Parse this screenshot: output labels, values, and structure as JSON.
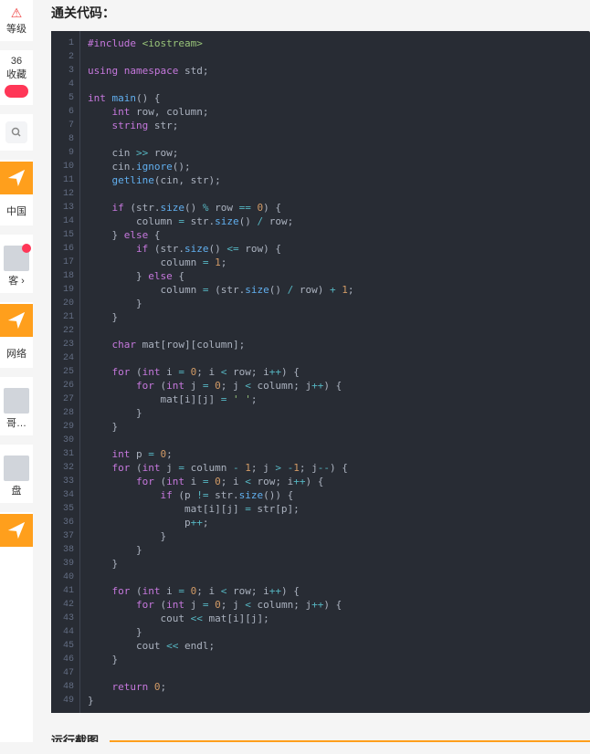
{
  "sidebar": {
    "level_label": "等级",
    "count": "36",
    "fav_label": "收藏",
    "country_label": "中国",
    "guest_label": "客 ›",
    "net_label": "网络",
    "dot_label": "哥…",
    "disk_label": "盘"
  },
  "heading": "通关代码：",
  "colors": {
    "bg": "#282c34",
    "gutter": "#636d83",
    "kw": "#c678dd",
    "id": "#e06c75",
    "fn": "#61afef",
    "num": "#d19a66",
    "op": "#56b6c2",
    "str": "#98c379"
  },
  "code": {
    "language": "cpp",
    "lines": [
      [
        [
          "pp",
          "#include"
        ],
        [
          "pl",
          " "
        ],
        [
          "inc",
          "<iostream>"
        ]
      ],
      [],
      [
        [
          "kw",
          "using"
        ],
        [
          "pl",
          " "
        ],
        [
          "kw",
          "namespace"
        ],
        [
          "pl",
          " std;"
        ]
      ],
      [],
      [
        [
          "ty",
          "int"
        ],
        [
          "pl",
          " "
        ],
        [
          "fn",
          "main"
        ],
        [
          "pl",
          "() {"
        ]
      ],
      [
        [
          "pl",
          "    "
        ],
        [
          "ty",
          "int"
        ],
        [
          "pl",
          " row, column;"
        ]
      ],
      [
        [
          "pl",
          "    "
        ],
        [
          "ty",
          "string"
        ],
        [
          "pl",
          " str;"
        ]
      ],
      [],
      [
        [
          "pl",
          "    cin "
        ],
        [
          "op",
          ">>"
        ],
        [
          "pl",
          " row;"
        ]
      ],
      [
        [
          "pl",
          "    cin."
        ],
        [
          "fn",
          "ignore"
        ],
        [
          "pl",
          "();"
        ]
      ],
      [
        [
          "pl",
          "    "
        ],
        [
          "fn",
          "getline"
        ],
        [
          "pl",
          "(cin, str);"
        ]
      ],
      [],
      [
        [
          "pl",
          "    "
        ],
        [
          "kw",
          "if"
        ],
        [
          "pl",
          " (str."
        ],
        [
          "fn",
          "size"
        ],
        [
          "pl",
          "() "
        ],
        [
          "op",
          "%"
        ],
        [
          "pl",
          " row "
        ],
        [
          "op",
          "=="
        ],
        [
          "pl",
          " "
        ],
        [
          "num",
          "0"
        ],
        [
          "pl",
          ") {"
        ]
      ],
      [
        [
          "pl",
          "        column "
        ],
        [
          "op",
          "="
        ],
        [
          "pl",
          " str."
        ],
        [
          "fn",
          "size"
        ],
        [
          "pl",
          "() "
        ],
        [
          "op",
          "/"
        ],
        [
          "pl",
          " row;"
        ]
      ],
      [
        [
          "pl",
          "    } "
        ],
        [
          "kw",
          "else"
        ],
        [
          "pl",
          " {"
        ]
      ],
      [
        [
          "pl",
          "        "
        ],
        [
          "kw",
          "if"
        ],
        [
          "pl",
          " (str."
        ],
        [
          "fn",
          "size"
        ],
        [
          "pl",
          "() "
        ],
        [
          "op",
          "<="
        ],
        [
          "pl",
          " row) {"
        ]
      ],
      [
        [
          "pl",
          "            column "
        ],
        [
          "op",
          "="
        ],
        [
          "pl",
          " "
        ],
        [
          "num",
          "1"
        ],
        [
          "pl",
          ";"
        ]
      ],
      [
        [
          "pl",
          "        } "
        ],
        [
          "kw",
          "else"
        ],
        [
          "pl",
          " {"
        ]
      ],
      [
        [
          "pl",
          "            column "
        ],
        [
          "op",
          "="
        ],
        [
          "pl",
          " (str."
        ],
        [
          "fn",
          "size"
        ],
        [
          "pl",
          "() "
        ],
        [
          "op",
          "/"
        ],
        [
          "pl",
          " row) "
        ],
        [
          "op",
          "+"
        ],
        [
          "pl",
          " "
        ],
        [
          "num",
          "1"
        ],
        [
          "pl",
          ";"
        ]
      ],
      [
        [
          "pl",
          "        }"
        ]
      ],
      [
        [
          "pl",
          "    }"
        ]
      ],
      [],
      [
        [
          "pl",
          "    "
        ],
        [
          "ty",
          "char"
        ],
        [
          "pl",
          " mat[row][column];"
        ]
      ],
      [],
      [
        [
          "pl",
          "    "
        ],
        [
          "kw",
          "for"
        ],
        [
          "pl",
          " ("
        ],
        [
          "ty",
          "int"
        ],
        [
          "pl",
          " i "
        ],
        [
          "op",
          "="
        ],
        [
          "pl",
          " "
        ],
        [
          "num",
          "0"
        ],
        [
          "pl",
          "; i "
        ],
        [
          "op",
          "<"
        ],
        [
          "pl",
          " row; i"
        ],
        [
          "op",
          "++"
        ],
        [
          "pl",
          ") {"
        ]
      ],
      [
        [
          "pl",
          "        "
        ],
        [
          "kw",
          "for"
        ],
        [
          "pl",
          " ("
        ],
        [
          "ty",
          "int"
        ],
        [
          "pl",
          " j "
        ],
        [
          "op",
          "="
        ],
        [
          "pl",
          " "
        ],
        [
          "num",
          "0"
        ],
        [
          "pl",
          "; j "
        ],
        [
          "op",
          "<"
        ],
        [
          "pl",
          " column; j"
        ],
        [
          "op",
          "++"
        ],
        [
          "pl",
          ") {"
        ]
      ],
      [
        [
          "pl",
          "            mat[i][j] "
        ],
        [
          "op",
          "="
        ],
        [
          "pl",
          " "
        ],
        [
          "str",
          "' '"
        ],
        [
          "pl",
          ";"
        ]
      ],
      [
        [
          "pl",
          "        }"
        ]
      ],
      [
        [
          "pl",
          "    }"
        ]
      ],
      [],
      [
        [
          "pl",
          "    "
        ],
        [
          "ty",
          "int"
        ],
        [
          "pl",
          " p "
        ],
        [
          "op",
          "="
        ],
        [
          "pl",
          " "
        ],
        [
          "num",
          "0"
        ],
        [
          "pl",
          ";"
        ]
      ],
      [
        [
          "pl",
          "    "
        ],
        [
          "kw",
          "for"
        ],
        [
          "pl",
          " ("
        ],
        [
          "ty",
          "int"
        ],
        [
          "pl",
          " j "
        ],
        [
          "op",
          "="
        ],
        [
          "pl",
          " column "
        ],
        [
          "op",
          "-"
        ],
        [
          "pl",
          " "
        ],
        [
          "num",
          "1"
        ],
        [
          "pl",
          "; j "
        ],
        [
          "op",
          ">"
        ],
        [
          "pl",
          " "
        ],
        [
          "op",
          "-"
        ],
        [
          "num",
          "1"
        ],
        [
          "pl",
          "; j"
        ],
        [
          "op",
          "--"
        ],
        [
          "pl",
          ") {"
        ]
      ],
      [
        [
          "pl",
          "        "
        ],
        [
          "kw",
          "for"
        ],
        [
          "pl",
          " ("
        ],
        [
          "ty",
          "int"
        ],
        [
          "pl",
          " i "
        ],
        [
          "op",
          "="
        ],
        [
          "pl",
          " "
        ],
        [
          "num",
          "0"
        ],
        [
          "pl",
          "; i "
        ],
        [
          "op",
          "<"
        ],
        [
          "pl",
          " row; i"
        ],
        [
          "op",
          "++"
        ],
        [
          "pl",
          ") {"
        ]
      ],
      [
        [
          "pl",
          "            "
        ],
        [
          "kw",
          "if"
        ],
        [
          "pl",
          " (p "
        ],
        [
          "op",
          "!="
        ],
        [
          "pl",
          " str."
        ],
        [
          "fn",
          "size"
        ],
        [
          "pl",
          "()) {"
        ]
      ],
      [
        [
          "pl",
          "                mat[i][j] "
        ],
        [
          "op",
          "="
        ],
        [
          "pl",
          " str[p];"
        ]
      ],
      [
        [
          "pl",
          "                p"
        ],
        [
          "op",
          "++"
        ],
        [
          "pl",
          ";"
        ]
      ],
      [
        [
          "pl",
          "            }"
        ]
      ],
      [
        [
          "pl",
          "        }"
        ]
      ],
      [
        [
          "pl",
          "    }"
        ]
      ],
      [],
      [
        [
          "pl",
          "    "
        ],
        [
          "kw",
          "for"
        ],
        [
          "pl",
          " ("
        ],
        [
          "ty",
          "int"
        ],
        [
          "pl",
          " i "
        ],
        [
          "op",
          "="
        ],
        [
          "pl",
          " "
        ],
        [
          "num",
          "0"
        ],
        [
          "pl",
          "; i "
        ],
        [
          "op",
          "<"
        ],
        [
          "pl",
          " row; i"
        ],
        [
          "op",
          "++"
        ],
        [
          "pl",
          ") {"
        ]
      ],
      [
        [
          "pl",
          "        "
        ],
        [
          "kw",
          "for"
        ],
        [
          "pl",
          " ("
        ],
        [
          "ty",
          "int"
        ],
        [
          "pl",
          " j "
        ],
        [
          "op",
          "="
        ],
        [
          "pl",
          " "
        ],
        [
          "num",
          "0"
        ],
        [
          "pl",
          "; j "
        ],
        [
          "op",
          "<"
        ],
        [
          "pl",
          " column; j"
        ],
        [
          "op",
          "++"
        ],
        [
          "pl",
          ") {"
        ]
      ],
      [
        [
          "pl",
          "            cout "
        ],
        [
          "op",
          "<<"
        ],
        [
          "pl",
          " mat[i][j];"
        ]
      ],
      [
        [
          "pl",
          "        }"
        ]
      ],
      [
        [
          "pl",
          "        cout "
        ],
        [
          "op",
          "<<"
        ],
        [
          "pl",
          " endl;"
        ]
      ],
      [
        [
          "pl",
          "    }"
        ]
      ],
      [],
      [
        [
          "pl",
          "    "
        ],
        [
          "kw",
          "return"
        ],
        [
          "pl",
          " "
        ],
        [
          "num",
          "0"
        ],
        [
          "pl",
          ";"
        ]
      ],
      [
        [
          "pl",
          "}"
        ]
      ]
    ]
  },
  "footer_heading": "运行截图"
}
